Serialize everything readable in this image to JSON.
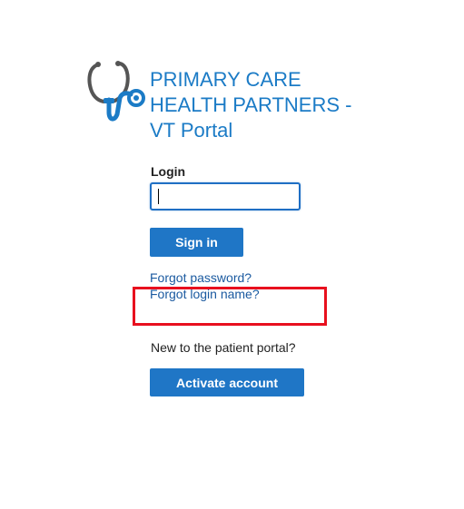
{
  "header": {
    "title_line1": "PRIMARY CARE",
    "title_line2": "HEALTH PARTNERS -",
    "title_line3": "VT Portal",
    "logo_icon": "stethoscope-icon",
    "brand_color": "#1b7bc6"
  },
  "login_form": {
    "login_label": "Login",
    "login_value": "",
    "signin_label": "Sign in",
    "forgot_password": "Forgot password?",
    "forgot_login_name": "Forgot login name?"
  },
  "activation": {
    "prompt": "New to the patient portal?",
    "activate_label": "Activate account"
  },
  "colors": {
    "button": "#1f76c6",
    "link": "#1b5aa0",
    "highlight": "#e8101e"
  }
}
